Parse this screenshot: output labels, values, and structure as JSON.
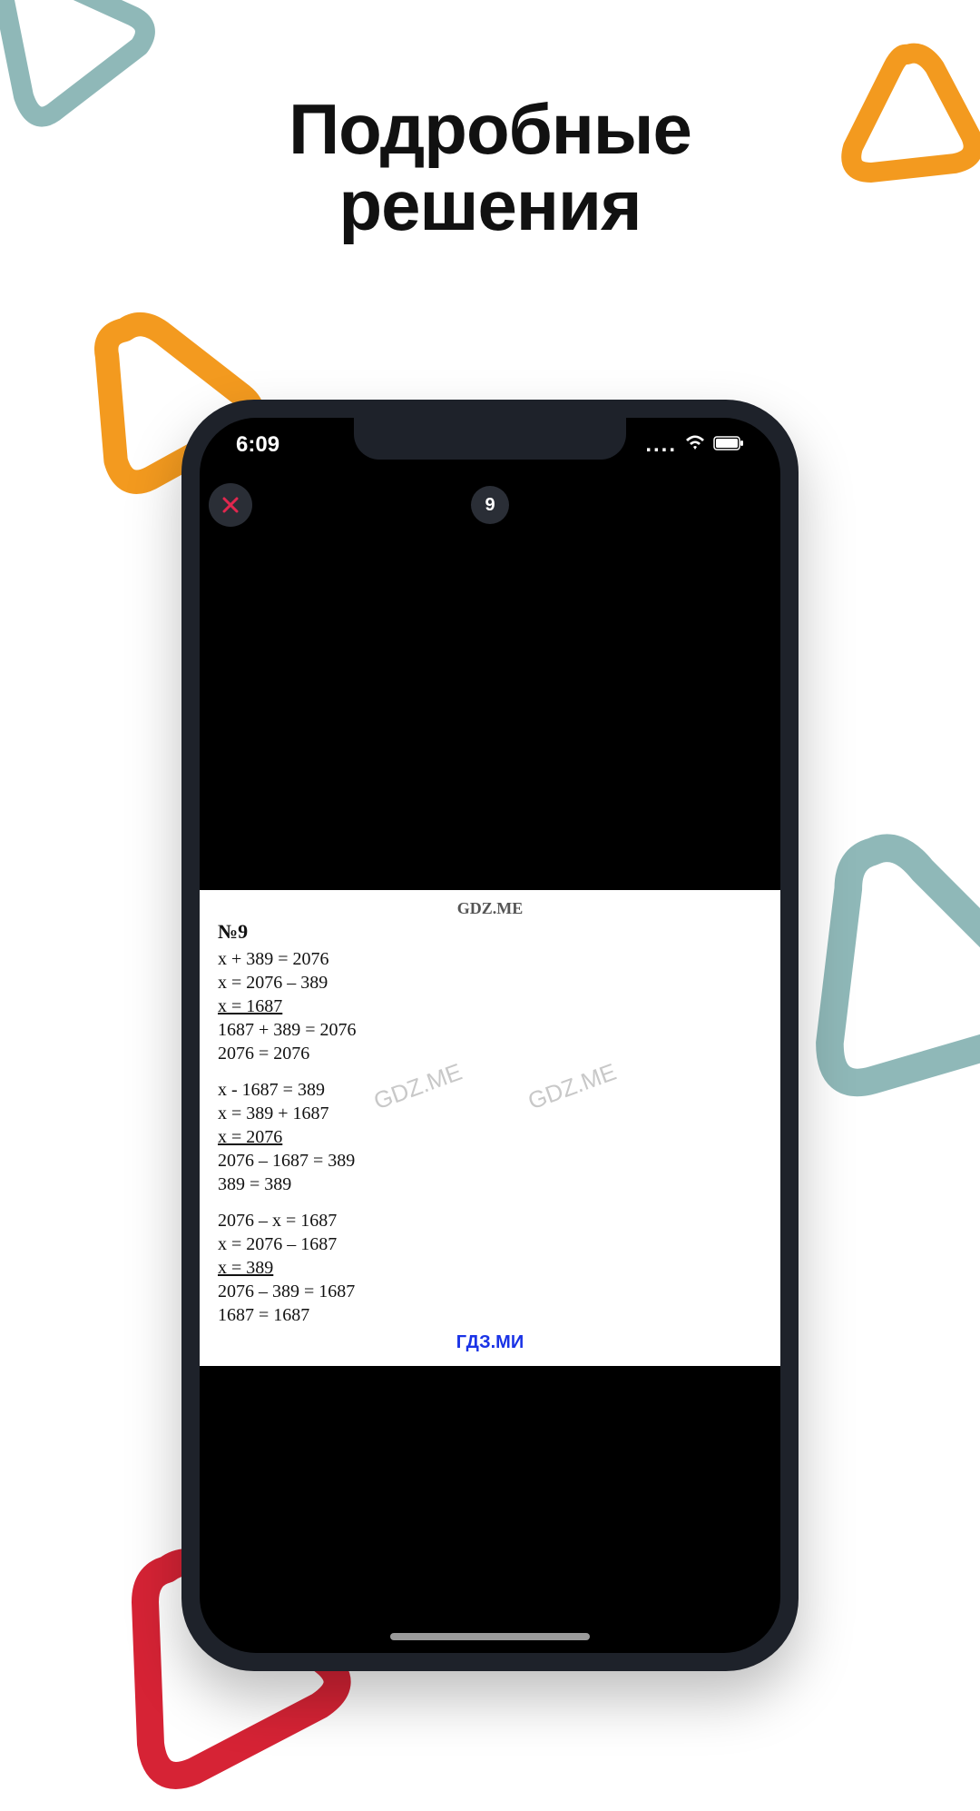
{
  "headline_line1": "Подробные",
  "headline_line2": "решения",
  "status": {
    "time": "6:09",
    "cell_dots": "....",
    "wifi": "wifi",
    "battery": "battery"
  },
  "nav": {
    "close": "✕",
    "title": "9"
  },
  "solution": {
    "watermark_top": "GDZ.ME",
    "watermark_diag": "GDZ.ME",
    "title": "№9",
    "block1": [
      "x + 389 = 2076",
      "x = 2076 – 389",
      "x = 1687",
      "1687 + 389 = 2076",
      "2076 = 2076"
    ],
    "block1_underline_idx": 2,
    "block2": [
      "x - 1687 = 389",
      "x = 389 + 1687",
      "x = 2076",
      "2076 – 1687 = 389",
      "389 = 389"
    ],
    "block2_underline_idx": 2,
    "block3": [
      "2076 – x = 1687",
      "x = 2076 – 1687",
      "x = 389",
      "2076 – 389 = 1687",
      "1687 = 1687"
    ],
    "block3_underline_idx": 2,
    "footer_brand": "ГДЗ.МИ"
  },
  "colors": {
    "orange": "#f39a1f",
    "teal": "#8fb8b8",
    "red": "#d62335",
    "headline": "#111"
  }
}
